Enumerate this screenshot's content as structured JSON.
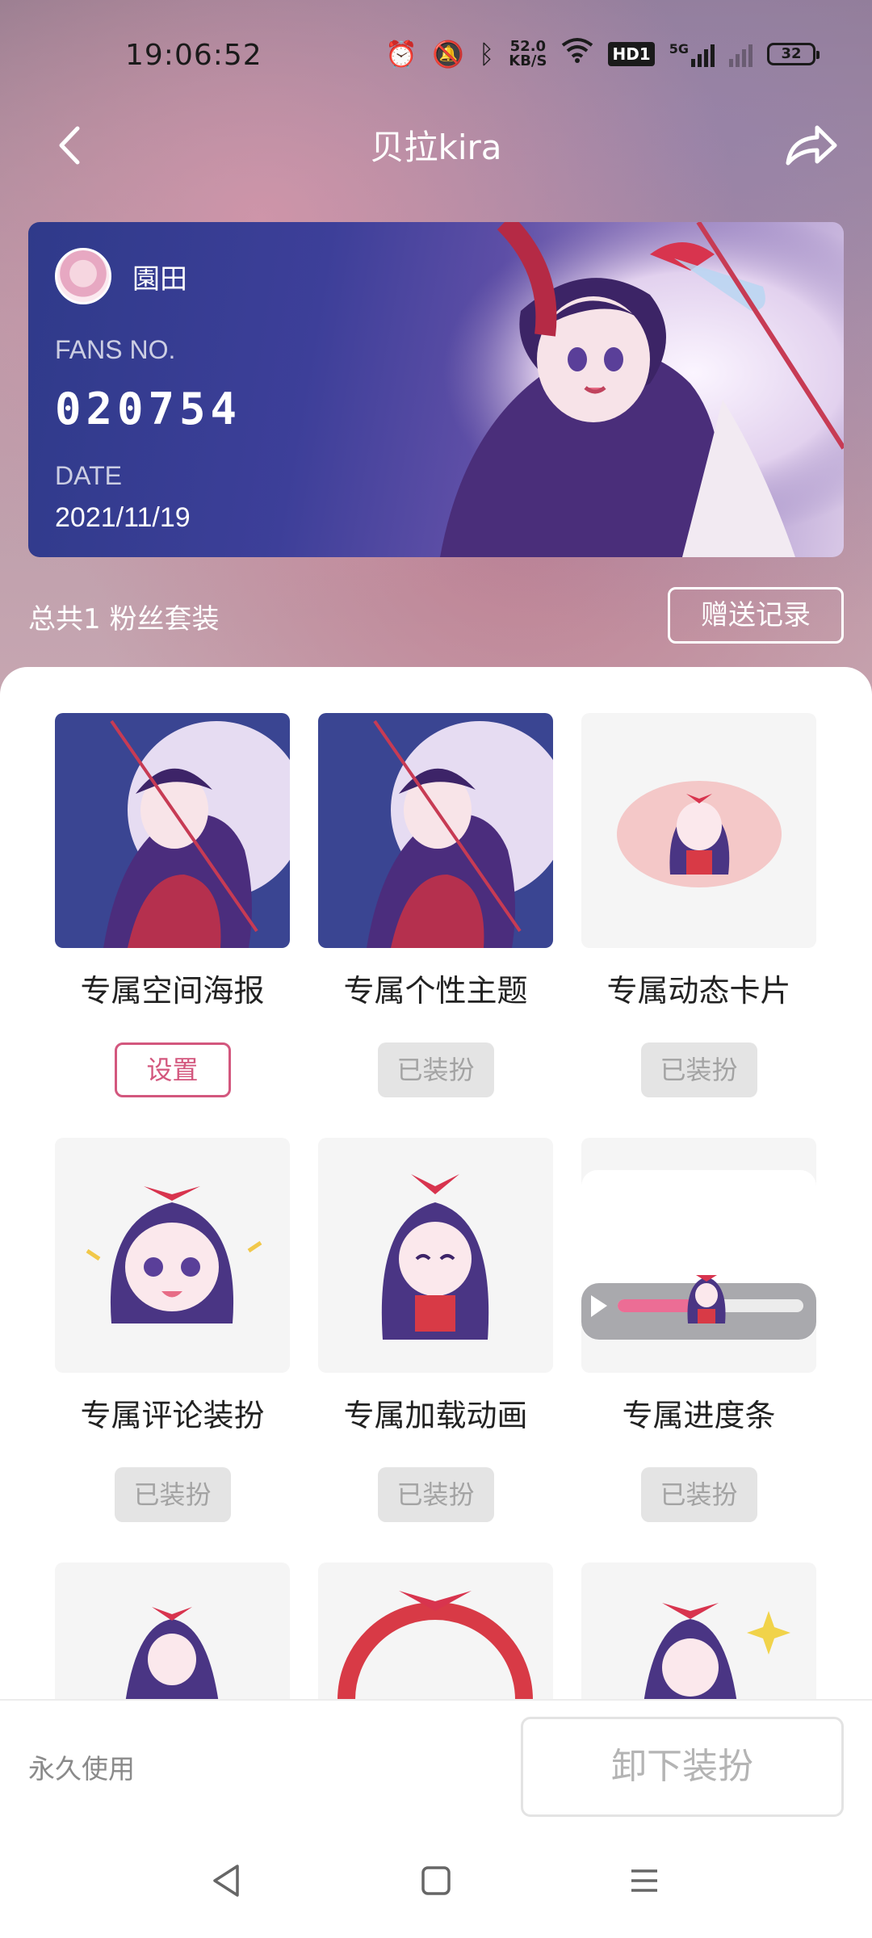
{
  "status_bar": {
    "time": "19:06:52",
    "net_speed_value": "52.0",
    "net_speed_unit": "KB/S",
    "hd_label": "HD1",
    "network_label": "5G",
    "battery": "32"
  },
  "header": {
    "title": "贝拉kira"
  },
  "fan_card": {
    "username": "園田",
    "fans_no_label": "FANS NO.",
    "fans_no": "020754",
    "date_label": "DATE",
    "date": "2021/11/19"
  },
  "suits": {
    "total_label": "总共1 粉丝套装",
    "gift_record_label": "赠送记录"
  },
  "items": [
    {
      "name": "专属空间海报",
      "action": "设置",
      "state": "set"
    },
    {
      "name": "专属个性主题",
      "action": "已装扮",
      "state": "equipped"
    },
    {
      "name": "专属动态卡片",
      "action": "已装扮",
      "state": "equipped"
    },
    {
      "name": "专属评论装扮",
      "action": "已装扮",
      "state": "equipped"
    },
    {
      "name": "专属加载动画",
      "action": "已装扮",
      "state": "equipped"
    },
    {
      "name": "专属进度条",
      "action": "已装扮",
      "state": "equipped"
    }
  ],
  "bottom_bar": {
    "permanent_label": "永久使用",
    "unequip_label": "卸下装扮"
  },
  "colors": {
    "accent": "#d3577e",
    "card_blue": "#2f3a8a",
    "button_disabled": "#e4e4e4"
  }
}
